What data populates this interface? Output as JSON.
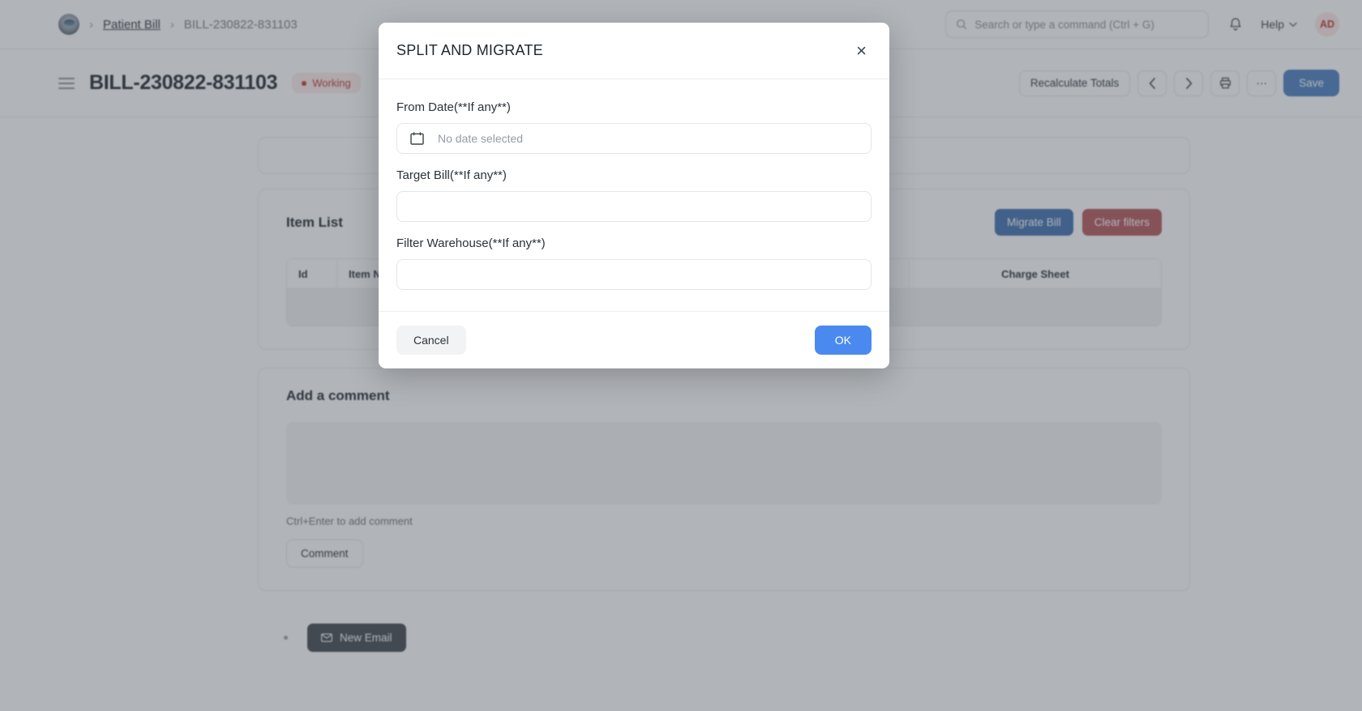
{
  "navbar": {
    "logo_icon": "app-logo",
    "breadcrumb": {
      "separator": "›",
      "parent": "Patient Bill",
      "current": "BILL-230822-831103"
    },
    "search": {
      "icon": "search-icon",
      "placeholder": "Search or type a command (Ctrl + G)",
      "value": ""
    },
    "bell_icon": "notification-bell-icon",
    "help_label": "Help",
    "help_chevron": "chevron-down-icon",
    "avatar_initials": "AD"
  },
  "page_header": {
    "menu_icon": "hamburger-menu-icon",
    "title": "BILL-230822-831103",
    "status_badge": "Working",
    "status_color": "#c0392b",
    "toolbar": {
      "recalculate_label": "Recalculate Totals",
      "prev_icon": "chevron-left-icon",
      "next_icon": "chevron-right-icon",
      "print_icon": "printer-icon",
      "more_icon": "ellipsis-icon",
      "more_label": "···",
      "save_label": "Save"
    }
  },
  "item_list": {
    "title": "Item List",
    "migrate_label": "Migrate Bill",
    "clear_filters_label": "Clear filters",
    "columns": [
      "Id",
      "Item Name",
      "Charge Sheet"
    ],
    "rows": [
      {
        "id": "",
        "item_name": "",
        "charge_sheet": ""
      }
    ]
  },
  "comment_section": {
    "title": "Add a comment",
    "textarea_value": "",
    "hint": "Ctrl+Enter to add comment",
    "submit_label": "Comment"
  },
  "bottom": {
    "new_email_icon": "envelope-icon",
    "new_email_label": "New Email"
  },
  "modal": {
    "title": "SPLIT AND MIGRATE",
    "close_icon": "close-icon",
    "close_label": "×",
    "fields": [
      {
        "label": "From Date(**If any**)",
        "icon": "calendar-icon",
        "placeholder": "No date selected",
        "value": ""
      },
      {
        "label": "Target Bill(**If any**)",
        "placeholder": "",
        "value": ""
      },
      {
        "label": "Filter Warehouse(**If any**)",
        "placeholder": "",
        "value": ""
      }
    ],
    "cancel_label": "Cancel",
    "ok_label": "OK",
    "primary_color": "#4a8af0"
  }
}
